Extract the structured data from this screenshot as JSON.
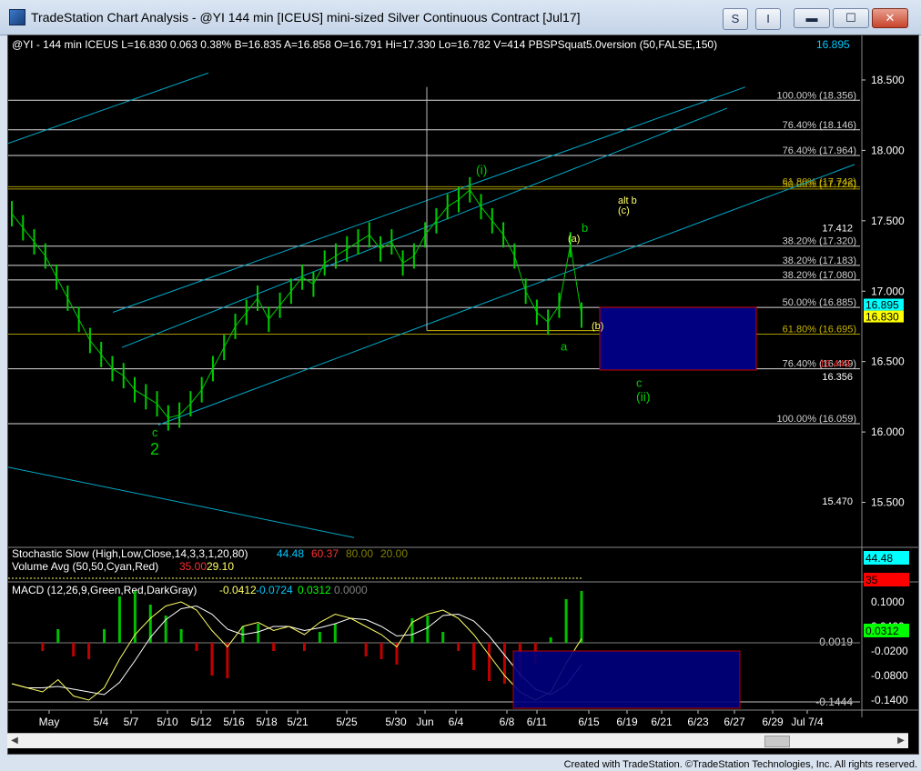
{
  "window": {
    "title": "TradeStation Chart Analysis - @YI 144 min [ICEUS] mini-sized Silver Continuous Contract [Jul17]",
    "btn_s": "S",
    "btn_i": "I",
    "min_label": "▬",
    "max_label": "☐",
    "close_label": "✕"
  },
  "header": {
    "symbol": "@YI - 144 min  ICEUS  L=16.830  0.063  0.38%  B=16.835  A=16.858  O=16.791  Hi=17.330  Lo=16.782  V=414  PBSPSquat5.0version (50,FALSE,150)",
    "last_value": "16.895"
  },
  "footer": "Created with TradeStation. ©TradeStation Technologies, Inc. All rights reserved.",
  "colors": {
    "price_bars": "#00cc00",
    "channel": "#00a8c8",
    "fib_line": "#ffffff",
    "fib_gold": "#c8b400",
    "wave_green": "#00cc00",
    "wave_yellow": "#ffff66",
    "target_box": "#000080",
    "target_border": "#cc0000"
  },
  "chart_data": [
    {
      "type": "line",
      "title": "@YI - 144 min ICEUS",
      "y_axis": {
        "ticks": [
          "18.500",
          "18.000",
          "17.500",
          "17.000",
          "16.500",
          "16.000",
          "15.500"
        ],
        "ylim": [
          15.2,
          18.7
        ]
      },
      "x_axis": {
        "ticks": [
          "May",
          "5/4",
          "5/7",
          "5/10",
          "5/12",
          "5/16",
          "5/18",
          "5/21",
          "5/25",
          "5/30",
          "Jun",
          "6/4",
          "6/8",
          "6/11",
          "6/15",
          "6/19",
          "6/21",
          "6/23",
          "6/27",
          "6/29",
          "Jul 7/4"
        ]
      },
      "series": [
        {
          "name": "price",
          "values": [
            17.55,
            17.45,
            17.35,
            17.25,
            17.1,
            16.95,
            16.8,
            16.65,
            16.55,
            16.45,
            16.4,
            16.3,
            16.25,
            16.2,
            16.1,
            16.12,
            16.2,
            16.3,
            16.45,
            16.6,
            16.75,
            16.85,
            16.95,
            16.8,
            16.9,
            17.0,
            17.1,
            17.05,
            17.2,
            17.25,
            17.3,
            17.35,
            17.4,
            17.3,
            17.35,
            17.2,
            17.25,
            17.4,
            17.5,
            17.6,
            17.65,
            17.72,
            17.6,
            17.5,
            17.4,
            17.25,
            17.0,
            16.85,
            16.78,
            16.9,
            17.33,
            16.83
          ]
        }
      ],
      "fib_levels": [
        {
          "label": "100.00% (18.356)",
          "value": 18.356
        },
        {
          "label": "76.40% (18.146)",
          "value": 18.146
        },
        {
          "label": "76.40% (17.964)",
          "value": 17.964
        },
        {
          "label": "61.80% (17.742)",
          "value": 17.742
        },
        {
          "label": "50.00% (17.726)",
          "value": 17.726
        },
        {
          "label": "38.20% (17.320)",
          "value": 17.32
        },
        {
          "label": "38.20% (17.183)",
          "value": 17.183
        },
        {
          "label": "38.20% (17.080)",
          "value": 17.08
        },
        {
          "label": "50.00% (16.885)",
          "value": 16.885
        },
        {
          "label": "61.80% (16.695)",
          "value": 16.695
        },
        {
          "label": "76.40% (16.449)",
          "value": 16.449
        },
        {
          "label": "100.00% (16.059)",
          "value": 16.059
        }
      ],
      "price_labels": [
        {
          "label": "17.412",
          "value": 17.412
        },
        {
          "label": "16.356",
          "value": 16.356
        },
        {
          "label": "15.470",
          "value": 15.47
        },
        {
          "label": "16.449",
          "value": 16.449
        }
      ],
      "wave_labels": [
        "(i)",
        "alt b",
        "(c)",
        "(a)",
        "b",
        "(b)",
        "a",
        "c",
        "(ii)",
        "c",
        "2"
      ],
      "axis_flags": [
        {
          "label": "16.895",
          "value": 16.895
        },
        {
          "label": "16.830",
          "value": 16.83
        }
      ]
    },
    {
      "type": "line",
      "title": "Stochastic Slow (High,Low,Close,14,3,3,1,20,80)",
      "legend": [
        "44.48",
        "60.37",
        "80.00",
        "20.00"
      ],
      "flag": "44.48"
    },
    {
      "type": "bar",
      "title": "Volume Avg (50,50,Cyan,Red)",
      "legend": [
        "35.00",
        "29.10"
      ],
      "flag": "35"
    },
    {
      "type": "line",
      "title": "MACD (12,26,9,Green,Red,DarkGray)",
      "legend": [
        "-0.0412",
        "-0.0724",
        "0.0312",
        "0.0000"
      ],
      "y_axis": {
        "ticks": [
          "0.1000",
          "0.0400",
          "-0.0200",
          "-0.0800",
          "-0.1400"
        ],
        "ylim": [
          -0.16,
          0.12
        ]
      },
      "price_labels": [
        {
          "label": "0.0019",
          "value": 0.0019
        },
        {
          "label": "-0.1444",
          "value": -0.1444
        }
      ],
      "flag": "0.0312"
    }
  ]
}
